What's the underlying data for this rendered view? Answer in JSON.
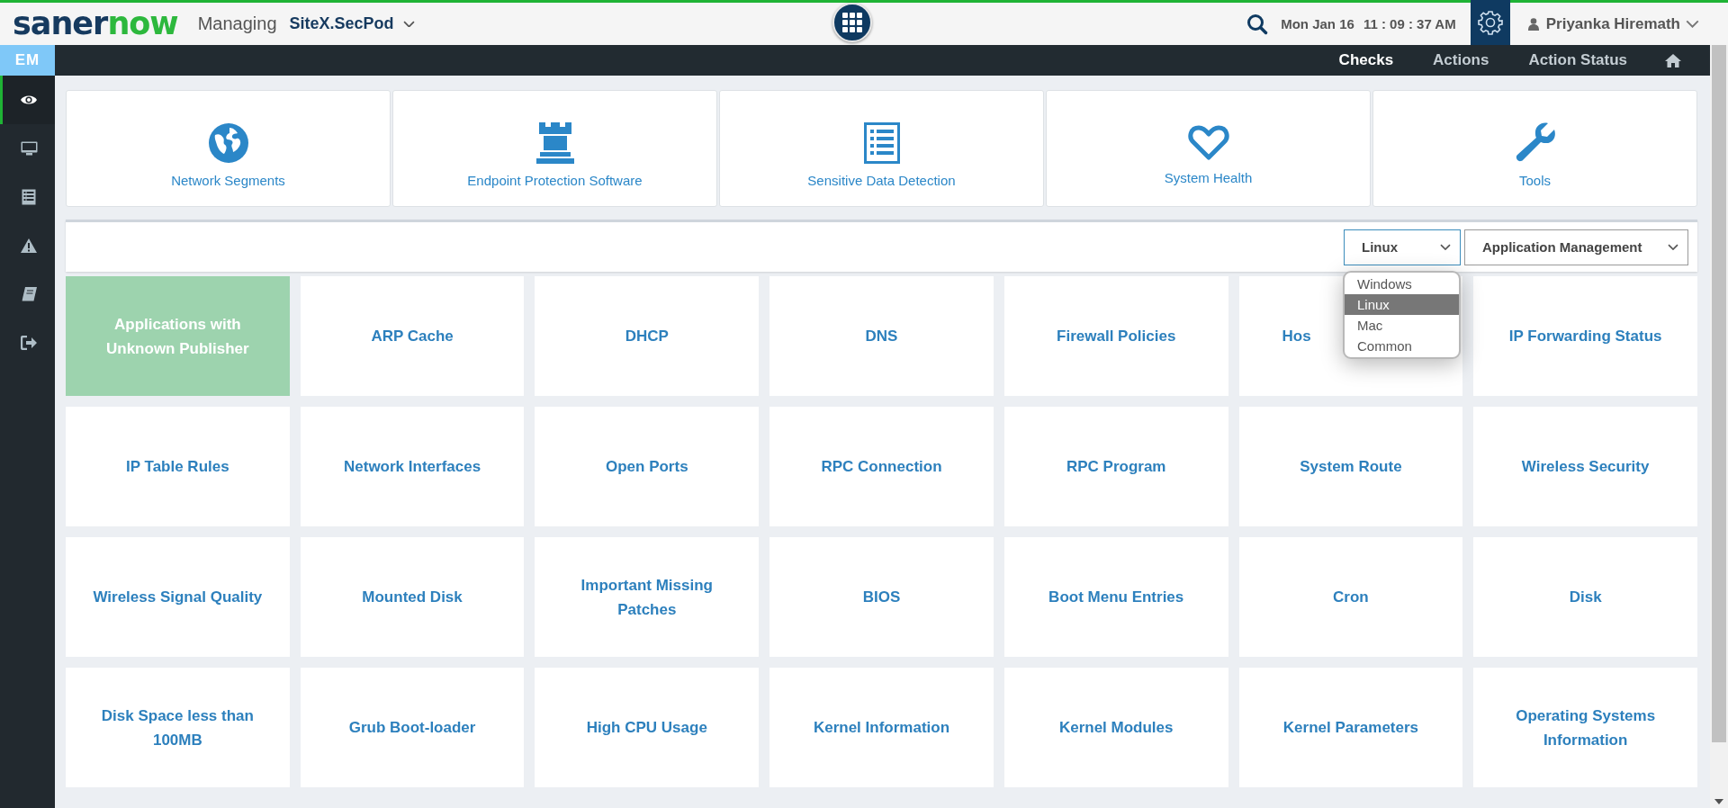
{
  "header": {
    "logo": [
      "saner",
      "now"
    ],
    "managing_label": "Managing",
    "site": "SiteX.SecPod",
    "date": "Mon Jan 16",
    "time": "11 : 09 : 37 AM",
    "user": "Priyanka Hiremath"
  },
  "sidebar": {
    "badge": "EM",
    "items": [
      {
        "selected": true
      },
      {
        "selected": false
      },
      {
        "selected": false
      },
      {
        "selected": false
      },
      {
        "selected": false
      },
      {
        "selected": false
      }
    ]
  },
  "subnav": {
    "tabs": [
      {
        "label": "Checks",
        "selected": true
      },
      {
        "label": "Actions",
        "selected": false
      },
      {
        "label": "Action Status",
        "selected": false
      }
    ]
  },
  "categories": [
    {
      "label": "Network Segments"
    },
    {
      "label": "Endpoint Protection Software"
    },
    {
      "label": "Sensitive Data Detection"
    },
    {
      "label": "System Health"
    },
    {
      "label": "Tools"
    }
  ],
  "filters": {
    "os_select": {
      "value": "Linux",
      "expanded": true,
      "options": [
        {
          "label": "Windows",
          "selected": false
        },
        {
          "label": "Linux",
          "selected": true
        },
        {
          "label": "Mac",
          "selected": false
        },
        {
          "label": "Common",
          "selected": false
        }
      ]
    },
    "category_select": {
      "value": "Application Management"
    }
  },
  "checks": [
    {
      "kind": "tile",
      "label": "Applications with\nUnknown Publisher",
      "selected": true
    },
    {
      "kind": "tile",
      "label": "ARP Cache",
      "selected": false
    },
    {
      "kind": "tile",
      "label": "DHCP",
      "selected": false
    },
    {
      "kind": "tile",
      "label": "DNS",
      "selected": false
    },
    {
      "kind": "tile",
      "label": "Firewall Policies",
      "selected": false
    },
    {
      "kind": "partial",
      "label": "Hos",
      "selected": false
    },
    {
      "kind": "tile",
      "label": "IP Forwarding Status",
      "selected": false
    },
    {
      "kind": "tile",
      "label": "IP Table Rules",
      "selected": false
    },
    {
      "kind": "tile",
      "label": "Network Interfaces",
      "selected": false
    },
    {
      "kind": "tile",
      "label": "Open Ports",
      "selected": false
    },
    {
      "kind": "tile",
      "label": "RPC Connection",
      "selected": false
    },
    {
      "kind": "tile",
      "label": "RPC Program",
      "selected": false
    },
    {
      "kind": "tile",
      "label": "System Route",
      "selected": false
    },
    {
      "kind": "tile",
      "label": "Wireless Security",
      "selected": false
    },
    {
      "kind": "tile",
      "label": "Wireless Signal Quality",
      "selected": false
    },
    {
      "kind": "tile",
      "label": "Mounted Disk",
      "selected": false
    },
    {
      "kind": "tile",
      "label": "Important Missing\nPatches",
      "selected": false
    },
    {
      "kind": "tile",
      "label": "BIOS",
      "selected": false
    },
    {
      "kind": "tile",
      "label": "Boot Menu Entries",
      "selected": false
    },
    {
      "kind": "tile",
      "label": "Cron",
      "selected": false
    },
    {
      "kind": "tile",
      "label": "Disk",
      "selected": false
    },
    {
      "kind": "tile",
      "label": "Disk Space less than\n100MB",
      "selected": false
    },
    {
      "kind": "tile",
      "label": "Grub Boot-loader",
      "selected": false
    },
    {
      "kind": "tile",
      "label": "High CPU Usage",
      "selected": false
    },
    {
      "kind": "tile",
      "label": "Kernel Information",
      "selected": false
    },
    {
      "kind": "tile",
      "label": "Kernel Modules",
      "selected": false
    },
    {
      "kind": "tile",
      "label": "Kernel Parameters",
      "selected": false
    },
    {
      "kind": "tile",
      "label": "Operating Systems\nInformation",
      "selected": false
    }
  ]
}
